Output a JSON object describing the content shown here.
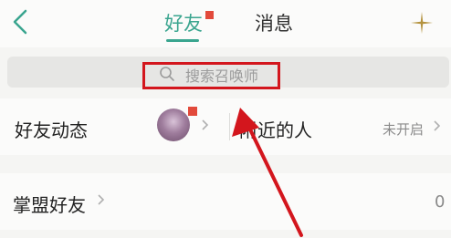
{
  "header": {
    "back_icon": "chevron-left-icon",
    "tabs": [
      {
        "label": "好友",
        "active": true,
        "has_badge": true
      },
      {
        "label": "消息",
        "active": false
      }
    ],
    "add_icon": "plus-sparkle-icon",
    "accent_color": "#3aa58f",
    "badge_color": "#e24a3b"
  },
  "search": {
    "icon": "search-icon",
    "placeholder": "搜索召唤师"
  },
  "rows": {
    "friend_activity": {
      "label": "好友动态",
      "has_badge": true
    },
    "nearby": {
      "label": "附近的人",
      "status": "未开启"
    },
    "league_friends": {
      "label": "掌盟好友",
      "count": "0"
    }
  },
  "annotation": {
    "highlight_color": "#d3161d"
  }
}
